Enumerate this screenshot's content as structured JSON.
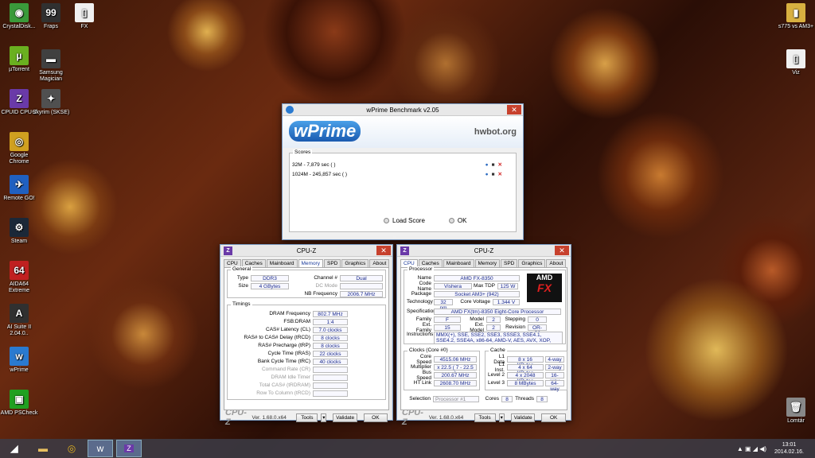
{
  "desktop": {
    "left_icons": [
      {
        "label": "CrystalDisk...",
        "glyph": "◉",
        "color": "#3a9a3a"
      },
      {
        "label": "µTorrent",
        "glyph": "µ",
        "color": "#6ab020"
      },
      {
        "label": "CPUID CPU-Z",
        "glyph": "Z",
        "color": "#6a3aa8"
      },
      {
        "label": "Google Chrome",
        "glyph": "◎",
        "color": "#d0a020"
      },
      {
        "label": "Remote GO!",
        "glyph": "✈",
        "color": "#2060c0"
      },
      {
        "label": "Steam",
        "glyph": "⚙",
        "color": "#1b2838"
      },
      {
        "label": "AIDA64 Extreme",
        "glyph": "64",
        "color": "#c02020"
      },
      {
        "label": "AI Suite II 2.04.0..",
        "glyph": "A",
        "color": "#303030"
      },
      {
        "label": "wPrime",
        "glyph": "w",
        "color": "#2a7ad0"
      },
      {
        "label": "AMD PSCheck",
        "glyph": "▣",
        "color": "#20a020"
      }
    ],
    "second_col_icons": [
      {
        "label": "Fraps",
        "glyph": "99",
        "color": "#303030"
      },
      {
        "label": "Samsung Magician",
        "glyph": "▬",
        "color": "#404040"
      },
      {
        "label": "Skyrim (SKSE)",
        "glyph": "✦",
        "color": "#505050"
      }
    ],
    "third_col_icons": [
      {
        "label": "FX",
        "glyph": "▯",
        "color": "#f0f0f0"
      }
    ],
    "right_icons": [
      {
        "label": "s775 vs AM3+",
        "glyph": "▮",
        "color": "#d8b040"
      },
      {
        "label": "Viz",
        "glyph": "▯",
        "color": "#f0f0f0"
      },
      {
        "label": "Lomtár",
        "glyph": "🗑",
        "color": "#888"
      }
    ]
  },
  "wprime": {
    "title": "wPrime Benchmark v2.05",
    "logo": "wPrime",
    "hwbot": "hwbot.org",
    "scores_label": "Scores",
    "scores": [
      "32M - 7,879 sec ( )",
      "1024M - 245,857 sec ( )"
    ],
    "load_score": "Load Score",
    "ok": "OK"
  },
  "cpuz_memory": {
    "title": "CPU-Z",
    "tabs": [
      "CPU",
      "Caches",
      "Mainboard",
      "Memory",
      "SPD",
      "Graphics",
      "About"
    ],
    "active_tab": "Memory",
    "general_label": "General",
    "type_label": "Type",
    "type": "DDR3",
    "size_label": "Size",
    "size": "4 GBytes",
    "channel_label": "Channel #",
    "channel": "Dual",
    "dcmode_label": "DC Mode",
    "dcmode": "",
    "nbfreq_label": "NB Frequency",
    "nbfreq": "2006.7 MHz",
    "timings_label": "Timings",
    "timings": [
      {
        "label": "DRAM Frequency",
        "value": "802.7 MHz",
        "dim": false
      },
      {
        "label": "FSB:DRAM",
        "value": "1:4",
        "dim": false
      },
      {
        "label": "CAS# Latency (CL)",
        "value": "7.0 clocks",
        "dim": false
      },
      {
        "label": "RAS# to CAS# Delay (tRCD)",
        "value": "8 clocks",
        "dim": false
      },
      {
        "label": "RAS# Precharge (tRP)",
        "value": "8 clocks",
        "dim": false
      },
      {
        "label": "Cycle Time (tRAS)",
        "value": "22 clocks",
        "dim": false
      },
      {
        "label": "Bank Cycle Time (tRC)",
        "value": "40 clocks",
        "dim": false
      },
      {
        "label": "Command Rate (CR)",
        "value": "",
        "dim": true
      },
      {
        "label": "DRAM Idle Timer",
        "value": "",
        "dim": true
      },
      {
        "label": "Total CAS# (tRDRAM)",
        "value": "",
        "dim": true
      },
      {
        "label": "Row To Column (tRCD)",
        "value": "",
        "dim": true
      }
    ],
    "brand": "CPU-Z",
    "version": "Ver. 1.68.0.x64",
    "tools": "Tools",
    "validate": "Validate",
    "ok": "OK"
  },
  "cpuz_cpu": {
    "title": "CPU-Z",
    "tabs": [
      "CPU",
      "Caches",
      "Mainboard",
      "Memory",
      "SPD",
      "Graphics",
      "About"
    ],
    "active_tab": "CPU",
    "processor_label": "Processor",
    "name_label": "Name",
    "name": "AMD FX-8350",
    "codename_label": "Code Name",
    "codename": "Vishera",
    "maxtdp_label": "Max TDP",
    "maxtdp": "125 W",
    "package_label": "Package",
    "package": "Socket AM3+ (942)",
    "technology_label": "Technology",
    "technology": "32 nm",
    "corevoltage_label": "Core Voltage",
    "corevoltage": "1.344 V",
    "spec_label": "Specification",
    "spec": "AMD FX(tm)-8350 Eight-Core Processor",
    "family_label": "Family",
    "family": "F",
    "model_label": "Model",
    "model": "2",
    "stepping_label": "Stepping",
    "stepping": "0",
    "extfamily_label": "Ext. Family",
    "extfamily": "15",
    "extmodel_label": "Ext. Model",
    "extmodel": "2",
    "revision_label": "Revision",
    "revision": "OR-C0",
    "instructions_label": "Instructions",
    "instructions": "MMX(+), SSE, SSE2, SSE3, SSSE3, SSE4.1, SSE4.2, SSE4A, x86-64, AMD-V, AES, AVX, XOP, FMA3, FMA4",
    "badge_amd": "AMD",
    "badge_fx": "FX",
    "clocks_label": "Clocks (Core #0)",
    "corespeed_label": "Core Speed",
    "corespeed": "4515.06 MHz",
    "multiplier_label": "Multiplier",
    "multiplier": "x 22.5 ( 7 - 22.5 )",
    "busspeed_label": "Bus Speed",
    "busspeed": "200.67 MHz",
    "htlink_label": "HT Link",
    "htlink": "2608.70 MHz",
    "cache_label": "Cache",
    "cache": [
      {
        "label": "L1 Data",
        "size": "8 x 16 KBytes",
        "way": "4-way"
      },
      {
        "label": "L1 Inst.",
        "size": "4 x 64 KBytes",
        "way": "2-way"
      },
      {
        "label": "Level 2",
        "size": "4 x 2048 KBytes",
        "way": "16-way"
      },
      {
        "label": "Level 3",
        "size": "8 MBytes",
        "way": "64-way"
      }
    ],
    "selection_label": "Selection",
    "selection": "Processor #1",
    "cores_label": "Cores",
    "cores": "8",
    "threads_label": "Threads",
    "threads": "8",
    "brand": "CPU-Z",
    "version": "Ver. 1.68.0.x64",
    "tools": "Tools",
    "validate": "Validate",
    "ok": "OK"
  },
  "taskbar": {
    "time": "13:01",
    "date": "2014.02.16.",
    "apps": [
      "start",
      "folder",
      "chrome",
      "wprime",
      "cpuz"
    ]
  }
}
